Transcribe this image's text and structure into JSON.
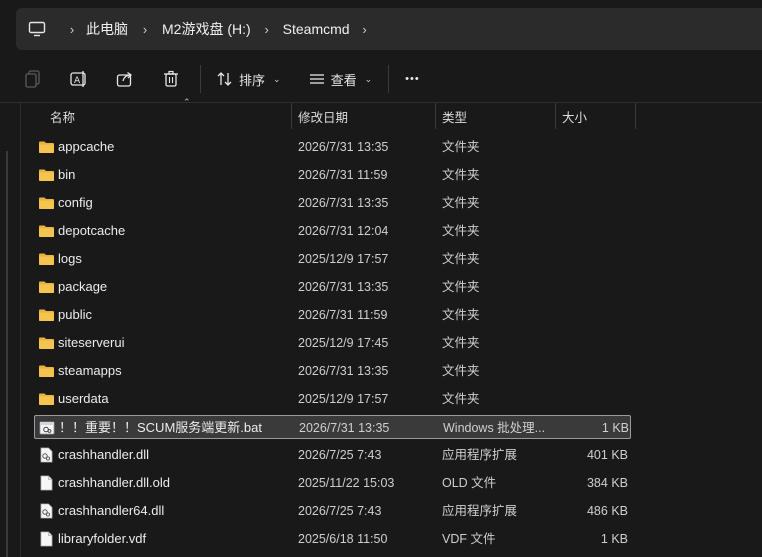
{
  "address": {
    "crumbs": [
      "此电脑",
      "M2游戏盘 (H:)",
      "Steamcmd"
    ],
    "separator": "›"
  },
  "toolbar": {
    "sort_label": "排序",
    "view_label": "查看",
    "more_label": "•••"
  },
  "columns": {
    "name": "名称",
    "date": "修改日期",
    "type": "类型",
    "size": "大小"
  },
  "colors": {
    "folder": "#e8b43a",
    "background": "#191919",
    "selected": "#3a3a3a"
  },
  "files": [
    {
      "name": "appcache",
      "date": "2026/7/31 13:35",
      "type": "文件夹",
      "size": "",
      "icon": "folder-icon"
    },
    {
      "name": "bin",
      "date": "2026/7/31 11:59",
      "type": "文件夹",
      "size": "",
      "icon": "folder-icon"
    },
    {
      "name": "config",
      "date": "2026/7/31 13:35",
      "type": "文件夹",
      "size": "",
      "icon": "folder-icon"
    },
    {
      "name": "depotcache",
      "date": "2026/7/31 12:04",
      "type": "文件夹",
      "size": "",
      "icon": "folder-icon"
    },
    {
      "name": "logs",
      "date": "2025/12/9 17:57",
      "type": "文件夹",
      "size": "",
      "icon": "folder-icon"
    },
    {
      "name": "package",
      "date": "2026/7/31 13:35",
      "type": "文件夹",
      "size": "",
      "icon": "folder-icon"
    },
    {
      "name": "public",
      "date": "2026/7/31 11:59",
      "type": "文件夹",
      "size": "",
      "icon": "folder-icon"
    },
    {
      "name": "siteserverui",
      "date": "2025/12/9 17:45",
      "type": "文件夹",
      "size": "",
      "icon": "folder-icon"
    },
    {
      "name": "steamapps",
      "date": "2026/7/31 13:35",
      "type": "文件夹",
      "size": "",
      "icon": "folder-icon"
    },
    {
      "name": "userdata",
      "date": "2025/12/9 17:57",
      "type": "文件夹",
      "size": "",
      "icon": "folder-icon"
    },
    {
      "name": "！！重要！！SCUM服务端更新.bat",
      "date": "2026/7/31 13:35",
      "type": "Windows 批处理...",
      "size": "1 KB",
      "icon": "batch-file-icon",
      "selected": true
    },
    {
      "name": "crashhandler.dll",
      "date": "2026/7/25 7:43",
      "type": "应用程序扩展",
      "size": "401 KB",
      "icon": "dll-file-icon"
    },
    {
      "name": "crashhandler.dll.old",
      "date": "2025/11/22 15:03",
      "type": "OLD 文件",
      "size": "384 KB",
      "icon": "generic-file-icon"
    },
    {
      "name": "crashhandler64.dll",
      "date": "2026/7/25 7:43",
      "type": "应用程序扩展",
      "size": "486 KB",
      "icon": "dll-file-icon"
    },
    {
      "name": "libraryfolder.vdf",
      "date": "2025/6/18 11:50",
      "type": "VDF 文件",
      "size": "1 KB",
      "icon": "generic-file-icon"
    }
  ]
}
